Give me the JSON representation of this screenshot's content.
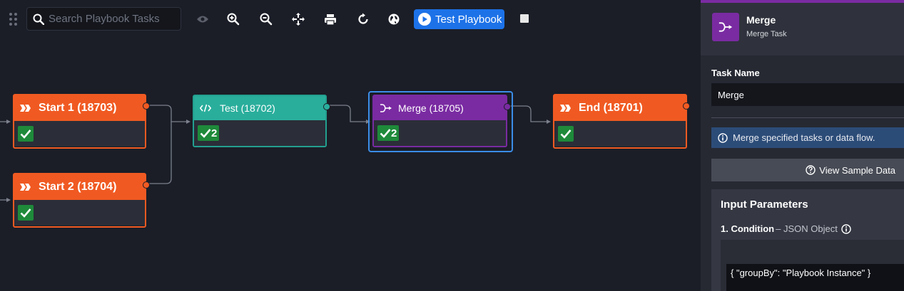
{
  "toolbar": {
    "search_placeholder": "Search Playbook Tasks",
    "test_button_label": "Test Playbook"
  },
  "nodes": [
    {
      "id": "start1",
      "title": "Start 1 (18703)",
      "kind": "start",
      "color": "#f05a22",
      "check_count": ""
    },
    {
      "id": "start2",
      "title": "Start 2 (18704)",
      "kind": "start",
      "color": "#f05a22",
      "check_count": ""
    },
    {
      "id": "test",
      "title": "Test (18702)",
      "kind": "code",
      "color": "#2aae9c",
      "check_count": "2"
    },
    {
      "id": "merge",
      "title": "Merge (18705)",
      "kind": "merge",
      "color": "#7a2ba2",
      "check_count": "2"
    },
    {
      "id": "end",
      "title": "End (18701)",
      "kind": "end",
      "color": "#f05a22",
      "check_count": ""
    }
  ],
  "panel": {
    "accent_color": "#7a2ba2",
    "header_title": "Merge",
    "header_subtitle": "Merge Task",
    "task_name_label": "Task Name",
    "task_name_value": "Merge",
    "info_text": "Merge specified tasks or data flow.",
    "view_sample_label": "View Sample Data",
    "input_params_title": "Input Parameters",
    "condition_label": "1. Condition",
    "condition_type": "– JSON Object",
    "condition_value": "{ \"groupBy\": \"Playbook Instance\" }"
  }
}
